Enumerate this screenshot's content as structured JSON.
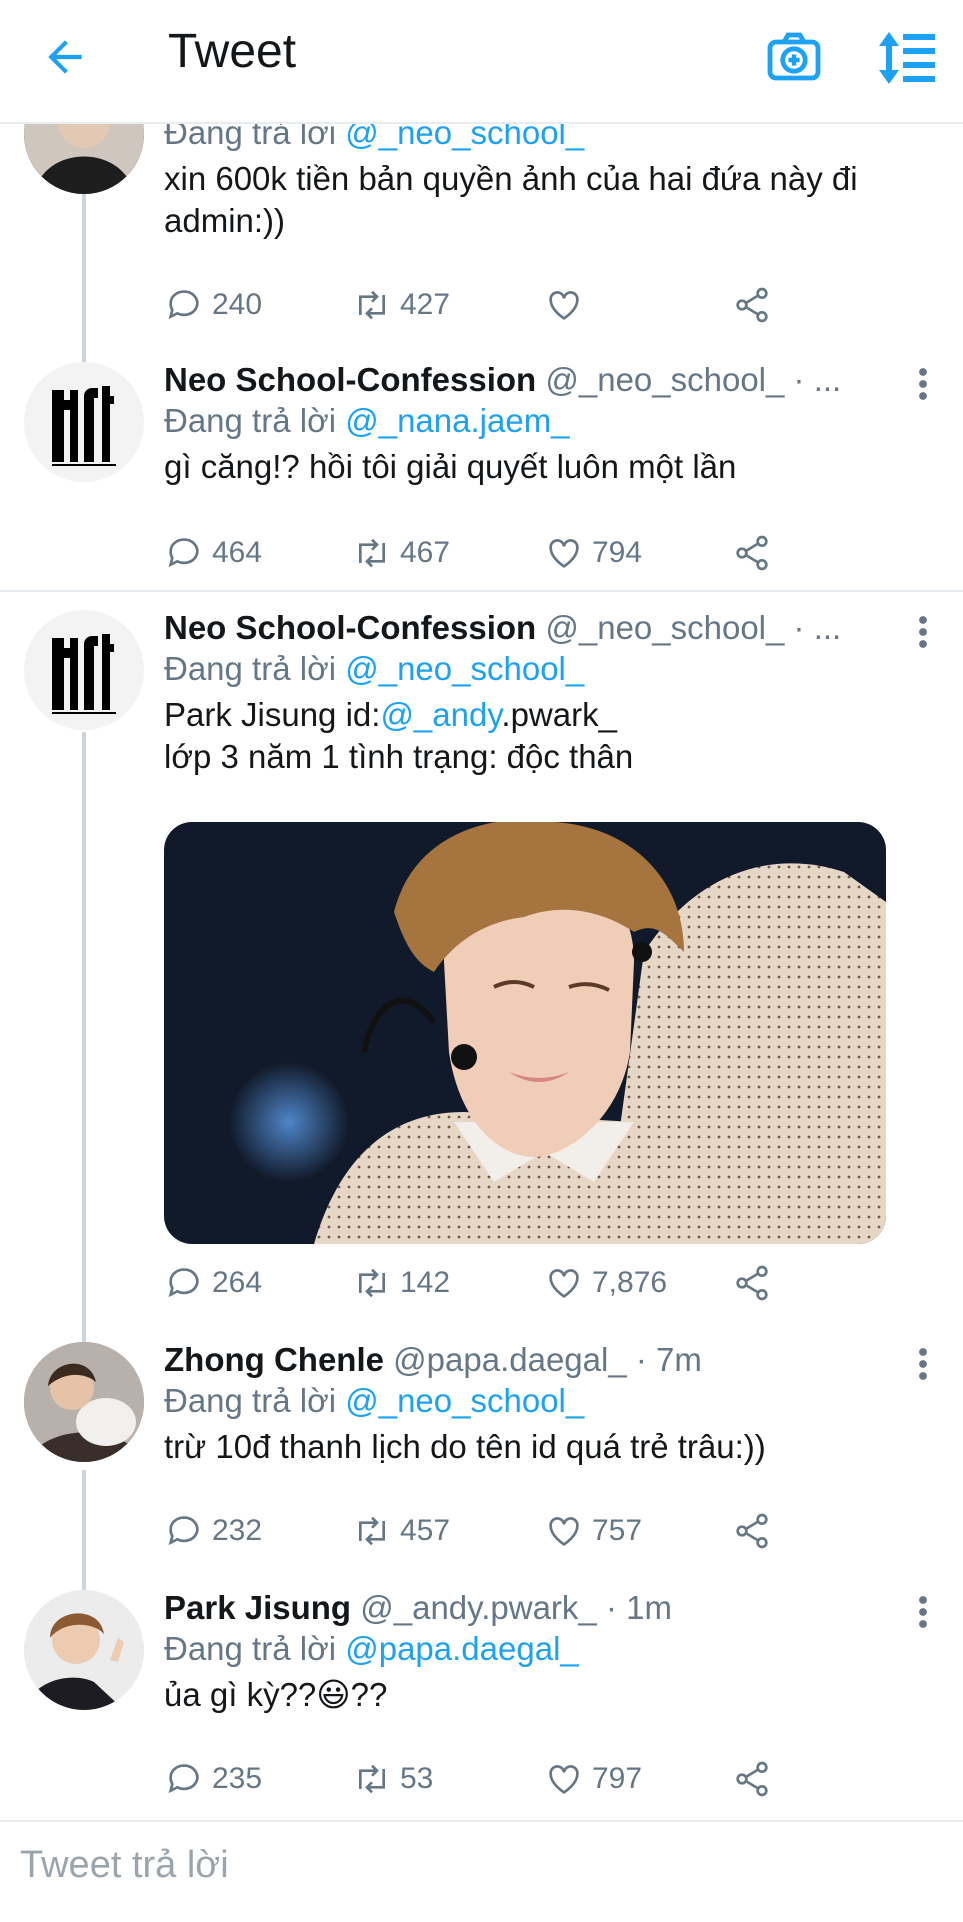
{
  "header": {
    "title": "Tweet",
    "back_icon": "arrow-left-icon",
    "camera_icon": "camera-icon",
    "sort_icon": "sort-icon"
  },
  "colors": {
    "accent": "#1da1f2",
    "muted": "#657786",
    "text": "#14171a",
    "border": "#e6ecf0"
  },
  "tweets": [
    {
      "reply_prefix": "Đang trả lời",
      "reply_to": "@_neo_school_",
      "text": "xin 600k tiền bản quyền ảnh của hai đứa này đi admin:))",
      "counts": {
        "replies": "240",
        "retweets": "427",
        "likes": ""
      }
    },
    {
      "name": "Neo School-Confession",
      "handle": "@_neo_school_",
      "time": "· ...",
      "reply_prefix": "Đang trả lời",
      "reply_to": "@_nana.jaem_",
      "text": "gì căng!? hồi tôi giải quyết luôn một lần",
      "counts": {
        "replies": "464",
        "retweets": "467",
        "likes": "794"
      }
    },
    {
      "name": "Neo School-Confession",
      "handle": "@_neo_school_",
      "time": "· ...",
      "reply_prefix": "Đang trả lời",
      "reply_to": "@_neo_school_",
      "text_prefix": "Park Jisung id:",
      "text_mention": "@_andy",
      "text_suffix": ".pwark_",
      "text_line2": "lớp 3 năm 1 tình trạng: độc thân",
      "counts": {
        "replies": "264",
        "retweets": "142",
        "likes": "7,876"
      }
    },
    {
      "name": "Zhong Chenle",
      "handle": "@papa.daegal_",
      "time": "· 7m",
      "reply_prefix": "Đang trả lời",
      "reply_to": "@_neo_school_",
      "text": "trừ 10đ thanh lịch do tên id quá trẻ trâu:))",
      "counts": {
        "replies": "232",
        "retweets": "457",
        "likes": "757"
      }
    },
    {
      "name": "Park Jisung",
      "handle": "@_andy.pwark_",
      "time": "· 1m",
      "reply_prefix": "Đang trả lời",
      "reply_to": "@papa.daegal_",
      "text": "ủa gì kỳ??😃??",
      "counts": {
        "replies": "235",
        "retweets": "53",
        "likes": "797"
      }
    }
  ],
  "composer": {
    "placeholder": "Tweet trả lời"
  }
}
